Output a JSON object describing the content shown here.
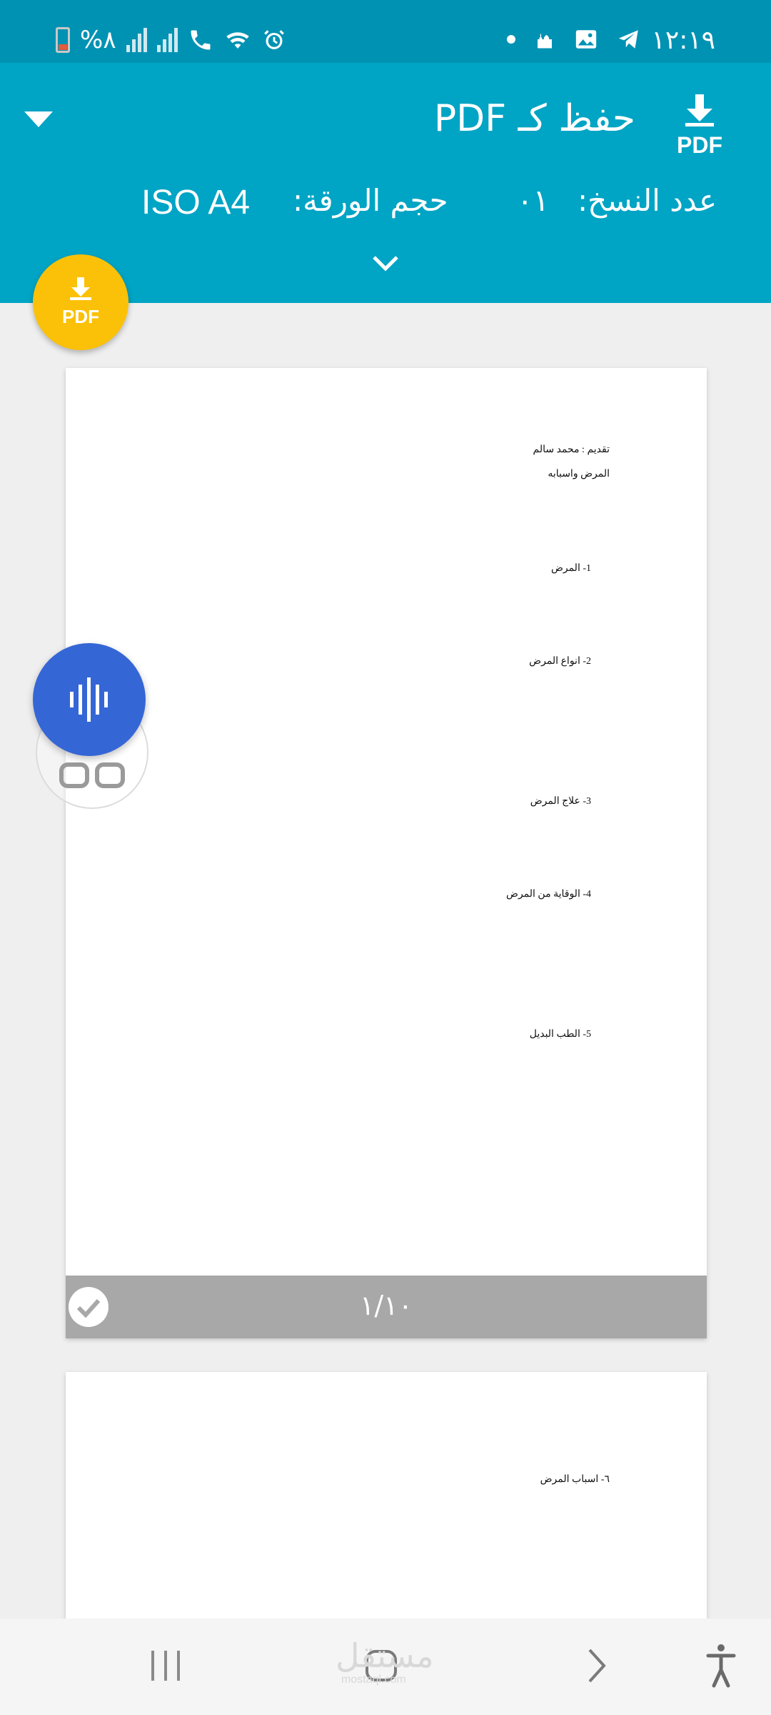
{
  "status_bar": {
    "time": "١٢:١٩",
    "battery_percent": "%٨",
    "icons": [
      "dot-icon",
      "mosque-icon",
      "gallery-icon",
      "telegram-icon",
      "alarm-icon",
      "wifi-icon",
      "call-icon",
      "signal-icon",
      "signal-icon",
      "battery-icon"
    ]
  },
  "header": {
    "title": "حفظ كـ PDF",
    "pdf_icon_label": "PDF",
    "copies_label": "عدد النسخ:",
    "copies_value": "٠١",
    "paper_size_label": "حجم الورقة:",
    "paper_size_value": "ISO A4"
  },
  "fab": {
    "label": "PDF",
    "icon": "pdf-download-icon"
  },
  "pages": [
    {
      "lines": [
        "تقديم : محمد سالم",
        "المرض واسبابه",
        "1-   المرض",
        "2-   انواع المرض",
        "3-   علاج المرض",
        "4-   الوقاية من المرض",
        "5-   الطب البديل"
      ],
      "page_number": "١/١٠",
      "selected": true
    },
    {
      "lines": [
        "٦- اسباب المرض"
      ]
    }
  ],
  "watermark": {
    "main": "مستقل",
    "sub": "mostaql.com"
  },
  "navbar": {
    "buttons": [
      "recent-apps-icon",
      "home-icon",
      "back-icon",
      "accessibility-icon"
    ]
  },
  "colors": {
    "header": "#00a4c4",
    "status_bar": "#0092b3",
    "fab": "#fbc108",
    "assistant": "#3566d6"
  }
}
